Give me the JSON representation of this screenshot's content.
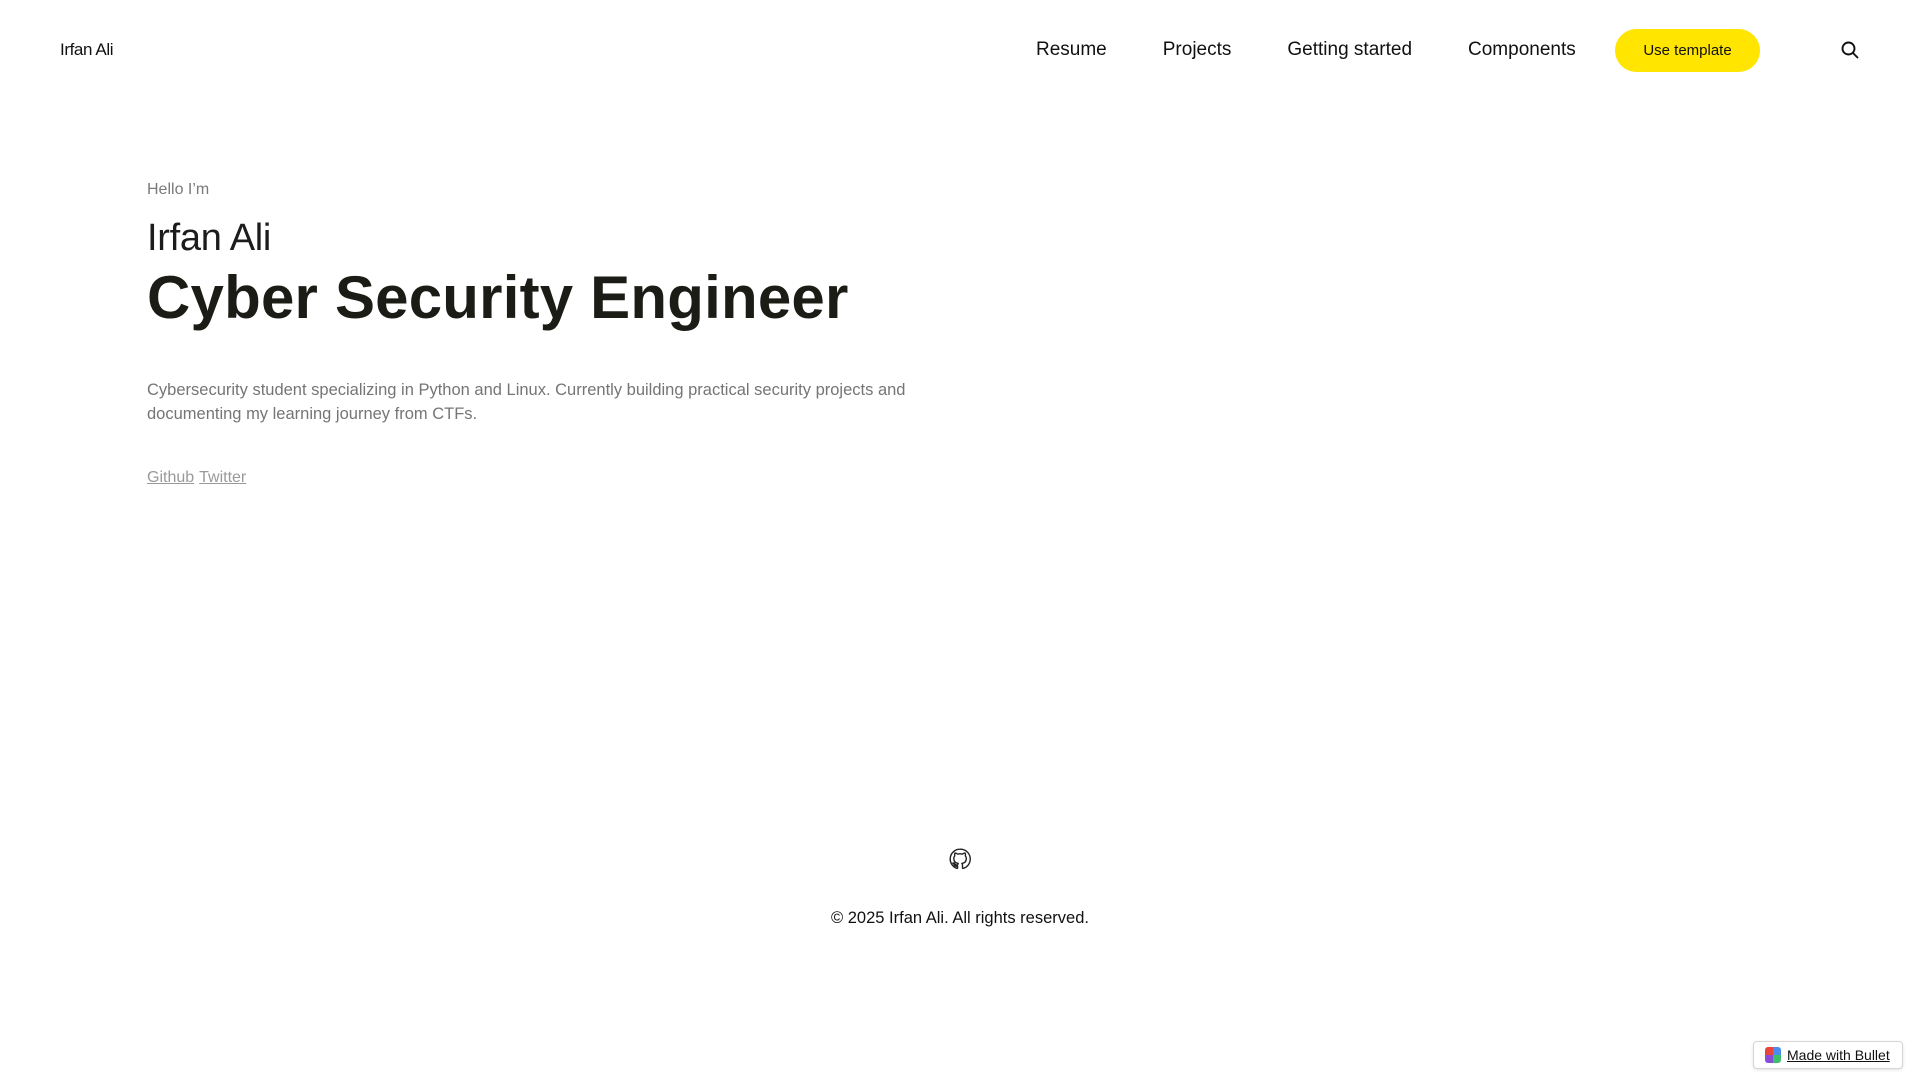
{
  "header": {
    "logo": "Irfan Ali",
    "nav": [
      "Resume",
      "Projects",
      "Getting started",
      "Components"
    ],
    "cta": "Use template",
    "search_icon": "search-icon"
  },
  "hero": {
    "greeting": "Hello I’m",
    "name": "Irfan Ali",
    "title": "Cyber Security Engineer",
    "bio": "Cybersecurity student specializing in Python and Linux. Currently building practical security projects and documenting my learning journey from CTFs.",
    "links": [
      "Github",
      "Twitter"
    ]
  },
  "footer": {
    "icon": "github-icon",
    "copyright": "© 2025 Irfan Ali. All rights reserved."
  },
  "badge": {
    "label": "Made with Bullet",
    "icon": "bullet-logo-icon"
  },
  "colors": {
    "accent": "#ffe500",
    "text": "#111111",
    "muted": "#757575",
    "link": "#9a9a9a"
  }
}
